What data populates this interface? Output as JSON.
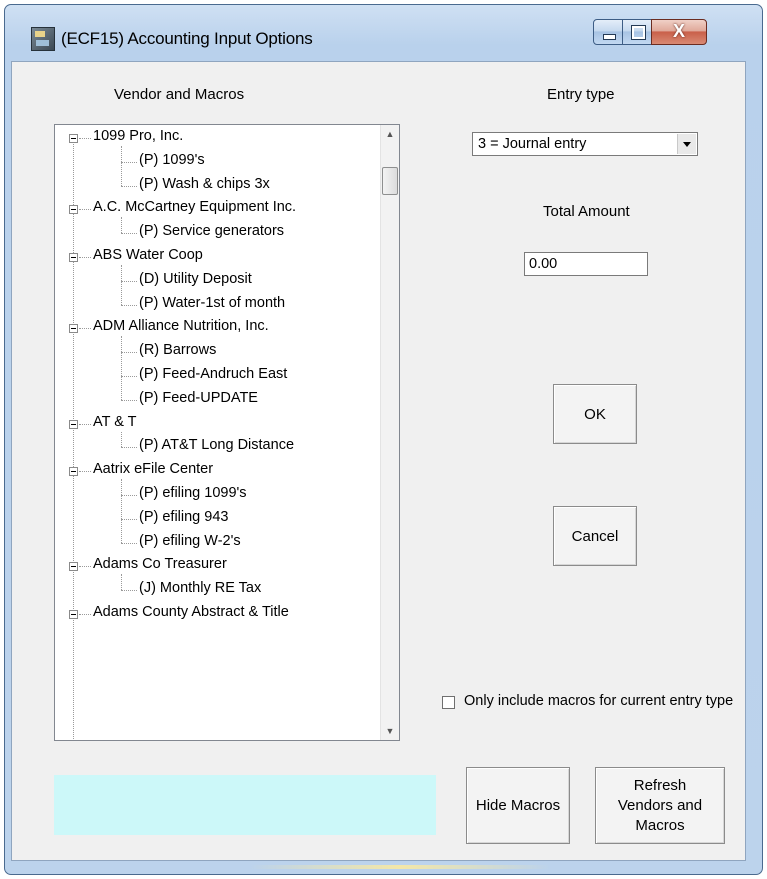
{
  "window": {
    "title": "(ECF15)  Accounting Input Options",
    "controls": {
      "minimize": "",
      "maximize": "",
      "close": "X"
    }
  },
  "labels": {
    "vendor_and_macros": "Vendor and Macros",
    "entry_type": "Entry type",
    "total_amount": "Total Amount"
  },
  "entry_type_select": {
    "selected": "3 = Journal entry"
  },
  "total_amount_input": {
    "value": "0.00"
  },
  "buttons": {
    "ok": "OK",
    "cancel": "Cancel",
    "hide_macros": "Hide Macros",
    "refresh": "Refresh Vendors and Macros"
  },
  "checkbox": {
    "label": "Only include macros for current entry type",
    "checked": false
  },
  "tree": {
    "vendors": [
      {
        "name": "1099 Pro, Inc.",
        "macros": [
          "(P) 1099's",
          "(P) Wash & chips 3x"
        ]
      },
      {
        "name": "A.C. McCartney Equipment Inc.",
        "macros": [
          "(P) Service generators"
        ]
      },
      {
        "name": "ABS Water Coop",
        "macros": [
          "(D) Utility Deposit",
          "(P) Water-1st of month"
        ]
      },
      {
        "name": "ADM Alliance Nutrition, Inc.",
        "macros": [
          "(R) Barrows",
          "(P) Feed-Andruch East",
          "(P) Feed-UPDATE"
        ]
      },
      {
        "name": "AT & T",
        "macros": [
          "(P) AT&T Long Distance"
        ]
      },
      {
        "name": "Aatrix eFile Center",
        "macros": [
          "(P) efiling 1099's",
          "(P) efiling 943",
          "(P) efiling W-2's"
        ]
      },
      {
        "name": "Adams Co Treasurer",
        "macros": [
          "(J) Monthly RE Tax"
        ]
      },
      {
        "name": "Adams County Abstract & Title",
        "macros": []
      }
    ]
  },
  "status_bar": {
    "text": "",
    "color": "#ccf8f9"
  }
}
